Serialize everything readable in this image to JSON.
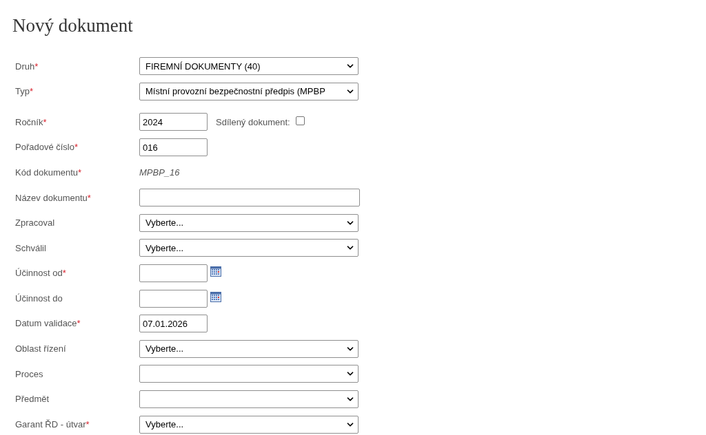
{
  "title": "Nový dokument",
  "fields": [
    {
      "kind": "select",
      "label": "Druh",
      "required_mark": "*",
      "value": "FIREMNÍ DOKUMENTY (40)"
    },
    {
      "kind": "select",
      "label": "Typ",
      "required_mark": "*",
      "value": "Místní provozní bezpečnostní předpis (MPBP"
    },
    {
      "kind": "short",
      "label": "Ročník",
      "required_mark": "*",
      "value": "2024",
      "checkbox": {
        "label": "Sdílený dokument:",
        "checked": false
      }
    },
    {
      "kind": "short",
      "label": "Pořadové číslo",
      "required_mark": "*",
      "value": "016"
    },
    {
      "kind": "code",
      "label": "Kód dokumentu",
      "required_mark": "*",
      "value": "MPBP_16"
    },
    {
      "kind": "text",
      "label": "Název dokumentu",
      "required_mark": "*"
    },
    {
      "kind": "select",
      "label": "Zpracoval",
      "value": "Vyberte..."
    },
    {
      "kind": "select",
      "label": "Schválil",
      "value": "Vyberte..."
    },
    {
      "kind": "date",
      "label": "Účinnost od",
      "required_mark": "*"
    },
    {
      "kind": "date",
      "label": "Účinnost do"
    },
    {
      "kind": "short",
      "label": "Datum validace",
      "required_mark": "*",
      "value": "07.01.2026"
    },
    {
      "kind": "select",
      "label": "Oblast řízení",
      "value": "Vyberte..."
    },
    {
      "kind": "select",
      "label": "Proces"
    },
    {
      "kind": "select",
      "label": "Předmět"
    },
    {
      "kind": "select",
      "label": "Garant ŘD - útvar",
      "required_mark": "*",
      "value": "Vyberte..."
    }
  ]
}
